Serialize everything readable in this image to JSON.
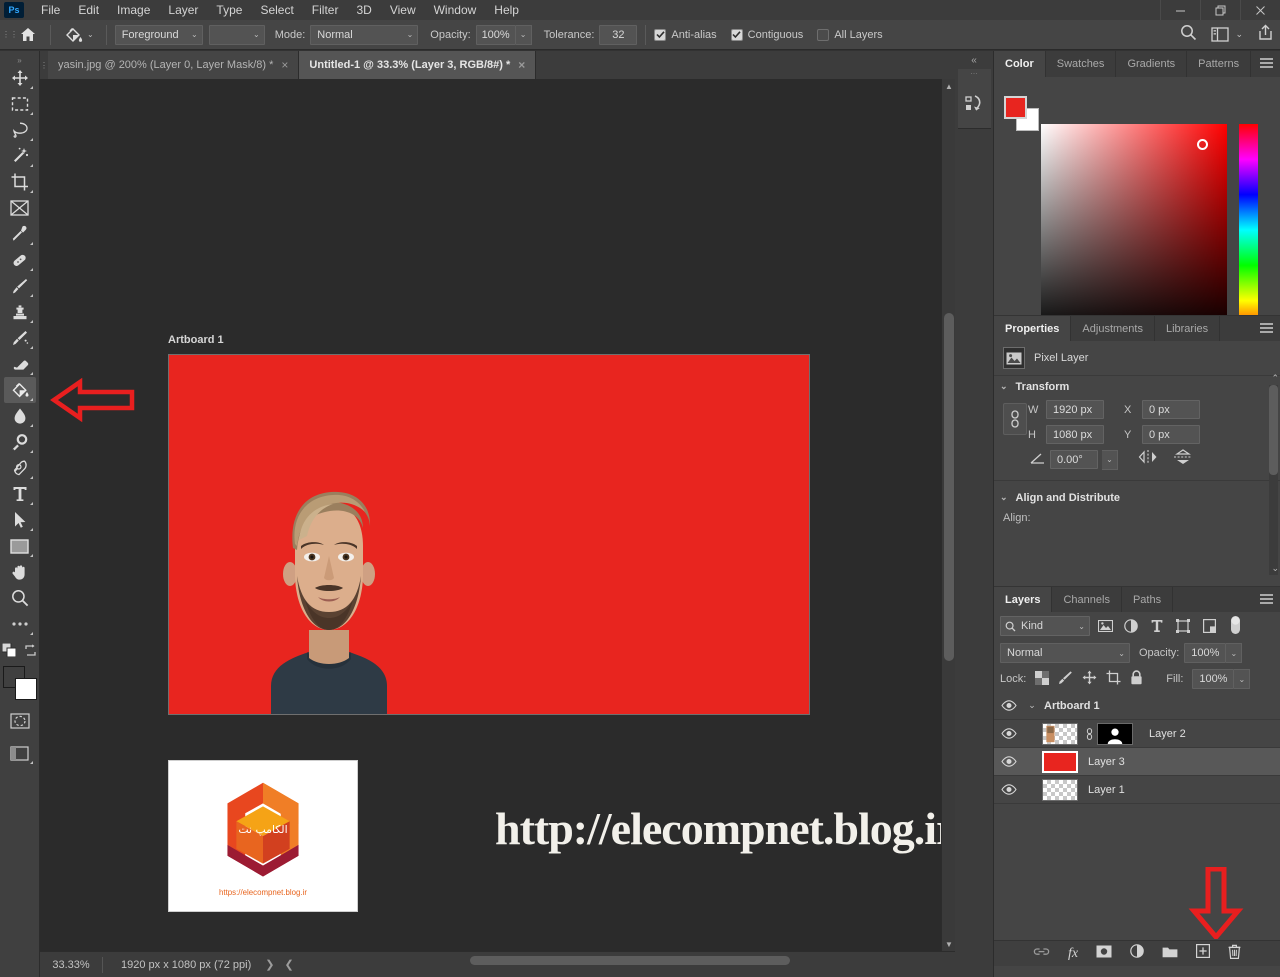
{
  "app": {
    "name": "Ps",
    "accent": "#31a8ff"
  },
  "menubar": {
    "items": [
      "File",
      "Edit",
      "Image",
      "Layer",
      "Type",
      "Select",
      "Filter",
      "3D",
      "View",
      "Window",
      "Help"
    ],
    "window_controls": [
      "minimize",
      "restore",
      "close"
    ]
  },
  "options_bar": {
    "home_icon": "home-icon",
    "tool_icon": "paint-bucket-icon",
    "fill_source": "Foreground",
    "pattern_value": "",
    "mode_label": "Mode:",
    "mode_value": "Normal",
    "opacity_label": "Opacity:",
    "opacity_value": "100%",
    "tolerance_label": "Tolerance:",
    "tolerance_value": "32",
    "antialias_label": "Anti-alias",
    "antialias_checked": true,
    "contiguous_label": "Contiguous",
    "contiguous_checked": true,
    "alllayers_label": "All Layers",
    "alllayers_checked": false,
    "right_icons": [
      "search-icon",
      "workspace-icon",
      "chevron-down-icon",
      "share-icon"
    ]
  },
  "toolbar": {
    "tools": [
      {
        "name": "move-tool",
        "icon": "move-icon",
        "active": false,
        "has_flyout": true
      },
      {
        "name": "rectangular-marquee-tool",
        "icon": "marquee-icon",
        "active": false,
        "has_flyout": true
      },
      {
        "name": "lasso-tool",
        "icon": "lasso-icon",
        "active": false,
        "has_flyout": true
      },
      {
        "name": "object-selection-tool",
        "icon": "magic-wand-icon",
        "active": false,
        "has_flyout": true
      },
      {
        "name": "crop-tool",
        "icon": "crop-icon",
        "active": false,
        "has_flyout": true
      },
      {
        "name": "frame-tool",
        "icon": "frame-icon",
        "active": false,
        "has_flyout": false
      },
      {
        "name": "eyedropper-tool",
        "icon": "eyedropper-icon",
        "active": false,
        "has_flyout": true
      },
      {
        "name": "spot-healing-brush-tool",
        "icon": "healing-brush-icon",
        "active": false,
        "has_flyout": true
      },
      {
        "name": "brush-tool",
        "icon": "brush-icon",
        "active": false,
        "has_flyout": true
      },
      {
        "name": "clone-stamp-tool",
        "icon": "clone-stamp-icon",
        "active": false,
        "has_flyout": true
      },
      {
        "name": "history-brush-tool",
        "icon": "history-brush-icon",
        "active": false,
        "has_flyout": true
      },
      {
        "name": "eraser-tool",
        "icon": "eraser-icon",
        "active": false,
        "has_flyout": true
      },
      {
        "name": "paint-bucket-tool",
        "icon": "paint-bucket-icon",
        "active": true,
        "has_flyout": true
      },
      {
        "name": "blur-tool",
        "icon": "blur-drop-icon",
        "active": false,
        "has_flyout": true
      },
      {
        "name": "dodge-tool",
        "icon": "dodge-icon",
        "active": false,
        "has_flyout": true
      },
      {
        "name": "pen-tool",
        "icon": "pen-icon",
        "active": false,
        "has_flyout": true
      },
      {
        "name": "horizontal-type-tool",
        "icon": "type-icon",
        "active": false,
        "has_flyout": true
      },
      {
        "name": "path-selection-tool",
        "icon": "path-arrow-icon",
        "active": false,
        "has_flyout": true
      },
      {
        "name": "rectangle-tool",
        "icon": "rectangle-icon",
        "active": false,
        "has_flyout": true
      },
      {
        "name": "hand-tool",
        "icon": "hand-icon",
        "active": false,
        "has_flyout": false
      },
      {
        "name": "zoom-tool",
        "icon": "zoom-icon",
        "active": false,
        "has_flyout": false
      },
      {
        "name": "edit-toolbar",
        "icon": "ellipsis-icon",
        "active": false,
        "has_flyout": true
      }
    ],
    "foreground_color": "#e8251f",
    "background_color": "#ffffff",
    "quickmask_icon": "quick-mask-icon",
    "screenmode_icon": "screen-mode-icon",
    "swap_icon": "swap-colors-icon",
    "default_icon": "default-colors-icon"
  },
  "tabs": [
    {
      "label": "yasin.jpg @ 200% (Layer 0, Layer Mask/8) *",
      "active": false,
      "close": "×"
    },
    {
      "label": "Untitled-1 @ 33.3% (Layer 3, RGB/8#) *",
      "active": true,
      "close": "×"
    }
  ],
  "canvas": {
    "artboard_label": "Artboard 1",
    "artboard_fill": "#e8251f",
    "watermark": "http://elecompnet.blog.ir",
    "logo_caption": "https://elecompnet.blog.ir",
    "logo_center_text": "الکامپ نت",
    "annotation_arrow_left": "left-arrow-annotation",
    "annotation_arrow_down": "down-arrow-annotation"
  },
  "statusbar": {
    "zoom": "33.33%",
    "doc_info": "1920 px x 1080 px (72 ppi)",
    "next_icon": "chevron-right-icon",
    "prev_icon": "chevron-left-icon"
  },
  "dock_strip": {
    "collapse_icon": "collapse-panels-icon",
    "icons": [
      "history-actions-icon"
    ]
  },
  "color_panel": {
    "tabs": [
      {
        "label": "Color",
        "active": true
      },
      {
        "label": "Swatches",
        "active": false
      },
      {
        "label": "Gradients",
        "active": false
      },
      {
        "label": "Patterns",
        "active": false
      }
    ],
    "menu_icon": "panel-menu-icon",
    "foreground": "#e8251f",
    "background": "#ffffff",
    "picker_marker_x": "88%",
    "picker_marker_y": "8%",
    "hue_marker_y": "96%"
  },
  "properties_panel": {
    "tabs": [
      {
        "label": "Properties",
        "active": true
      },
      {
        "label": "Adjustments",
        "active": false
      },
      {
        "label": "Libraries",
        "active": false
      }
    ],
    "menu_icon": "panel-menu-icon",
    "layer_type": "Pixel Layer",
    "layer_type_icon": "pixel-layer-icon",
    "transform": {
      "title": "Transform",
      "link_icon": "link-aspect-ratio-icon",
      "w_label": "W",
      "w_value": "1920 px",
      "h_label": "H",
      "h_value": "1080 px",
      "x_label": "X",
      "x_value": "0 px",
      "y_label": "Y",
      "y_value": "0 px",
      "angle_icon": "angle-icon",
      "angle_value": "0.00°",
      "flip_h_icon": "flip-horizontal-icon",
      "flip_v_icon": "flip-vertical-icon"
    },
    "align": {
      "title": "Align and Distribute",
      "align_label": "Align:"
    }
  },
  "layers_panel": {
    "tabs": [
      {
        "label": "Layers",
        "active": true
      },
      {
        "label": "Channels",
        "active": false
      },
      {
        "label": "Paths",
        "active": false
      }
    ],
    "menu_icon": "panel-menu-icon",
    "filter_kind": "Kind",
    "filter_search_icon": "search-icon",
    "filter_icons": [
      "filter-pixel-icon",
      "filter-adjustment-icon",
      "filter-type-icon",
      "filter-shape-icon",
      "filter-smart-object-icon"
    ],
    "filter_toggle": "filter-enable-toggle",
    "blend_mode": "Normal",
    "opacity_label": "Opacity:",
    "opacity_value": "100%",
    "lock_label": "Lock:",
    "lock_icons": [
      "lock-transparent-pixels-icon",
      "lock-image-pixels-icon",
      "lock-position-icon",
      "lock-artboard-icon",
      "lock-all-icon"
    ],
    "fill_label": "Fill:",
    "fill_value": "100%",
    "rows": [
      {
        "name": "Artboard 1",
        "type": "artboard",
        "visible": true,
        "selected": false,
        "expanded": true
      },
      {
        "name": "Layer 2",
        "type": "masked-pixel",
        "visible": true,
        "selected": false
      },
      {
        "name": "Layer 3",
        "type": "solid-red",
        "visible": true,
        "selected": true
      },
      {
        "name": "Layer 1",
        "type": "transparent",
        "visible": true,
        "selected": false
      }
    ],
    "bottom_icons": [
      "link-layers-icon",
      "layer-style-fx-icon",
      "add-layer-mask-icon",
      "new-adjustment-layer-icon",
      "new-group-icon",
      "new-layer-icon",
      "delete-layer-icon"
    ]
  }
}
